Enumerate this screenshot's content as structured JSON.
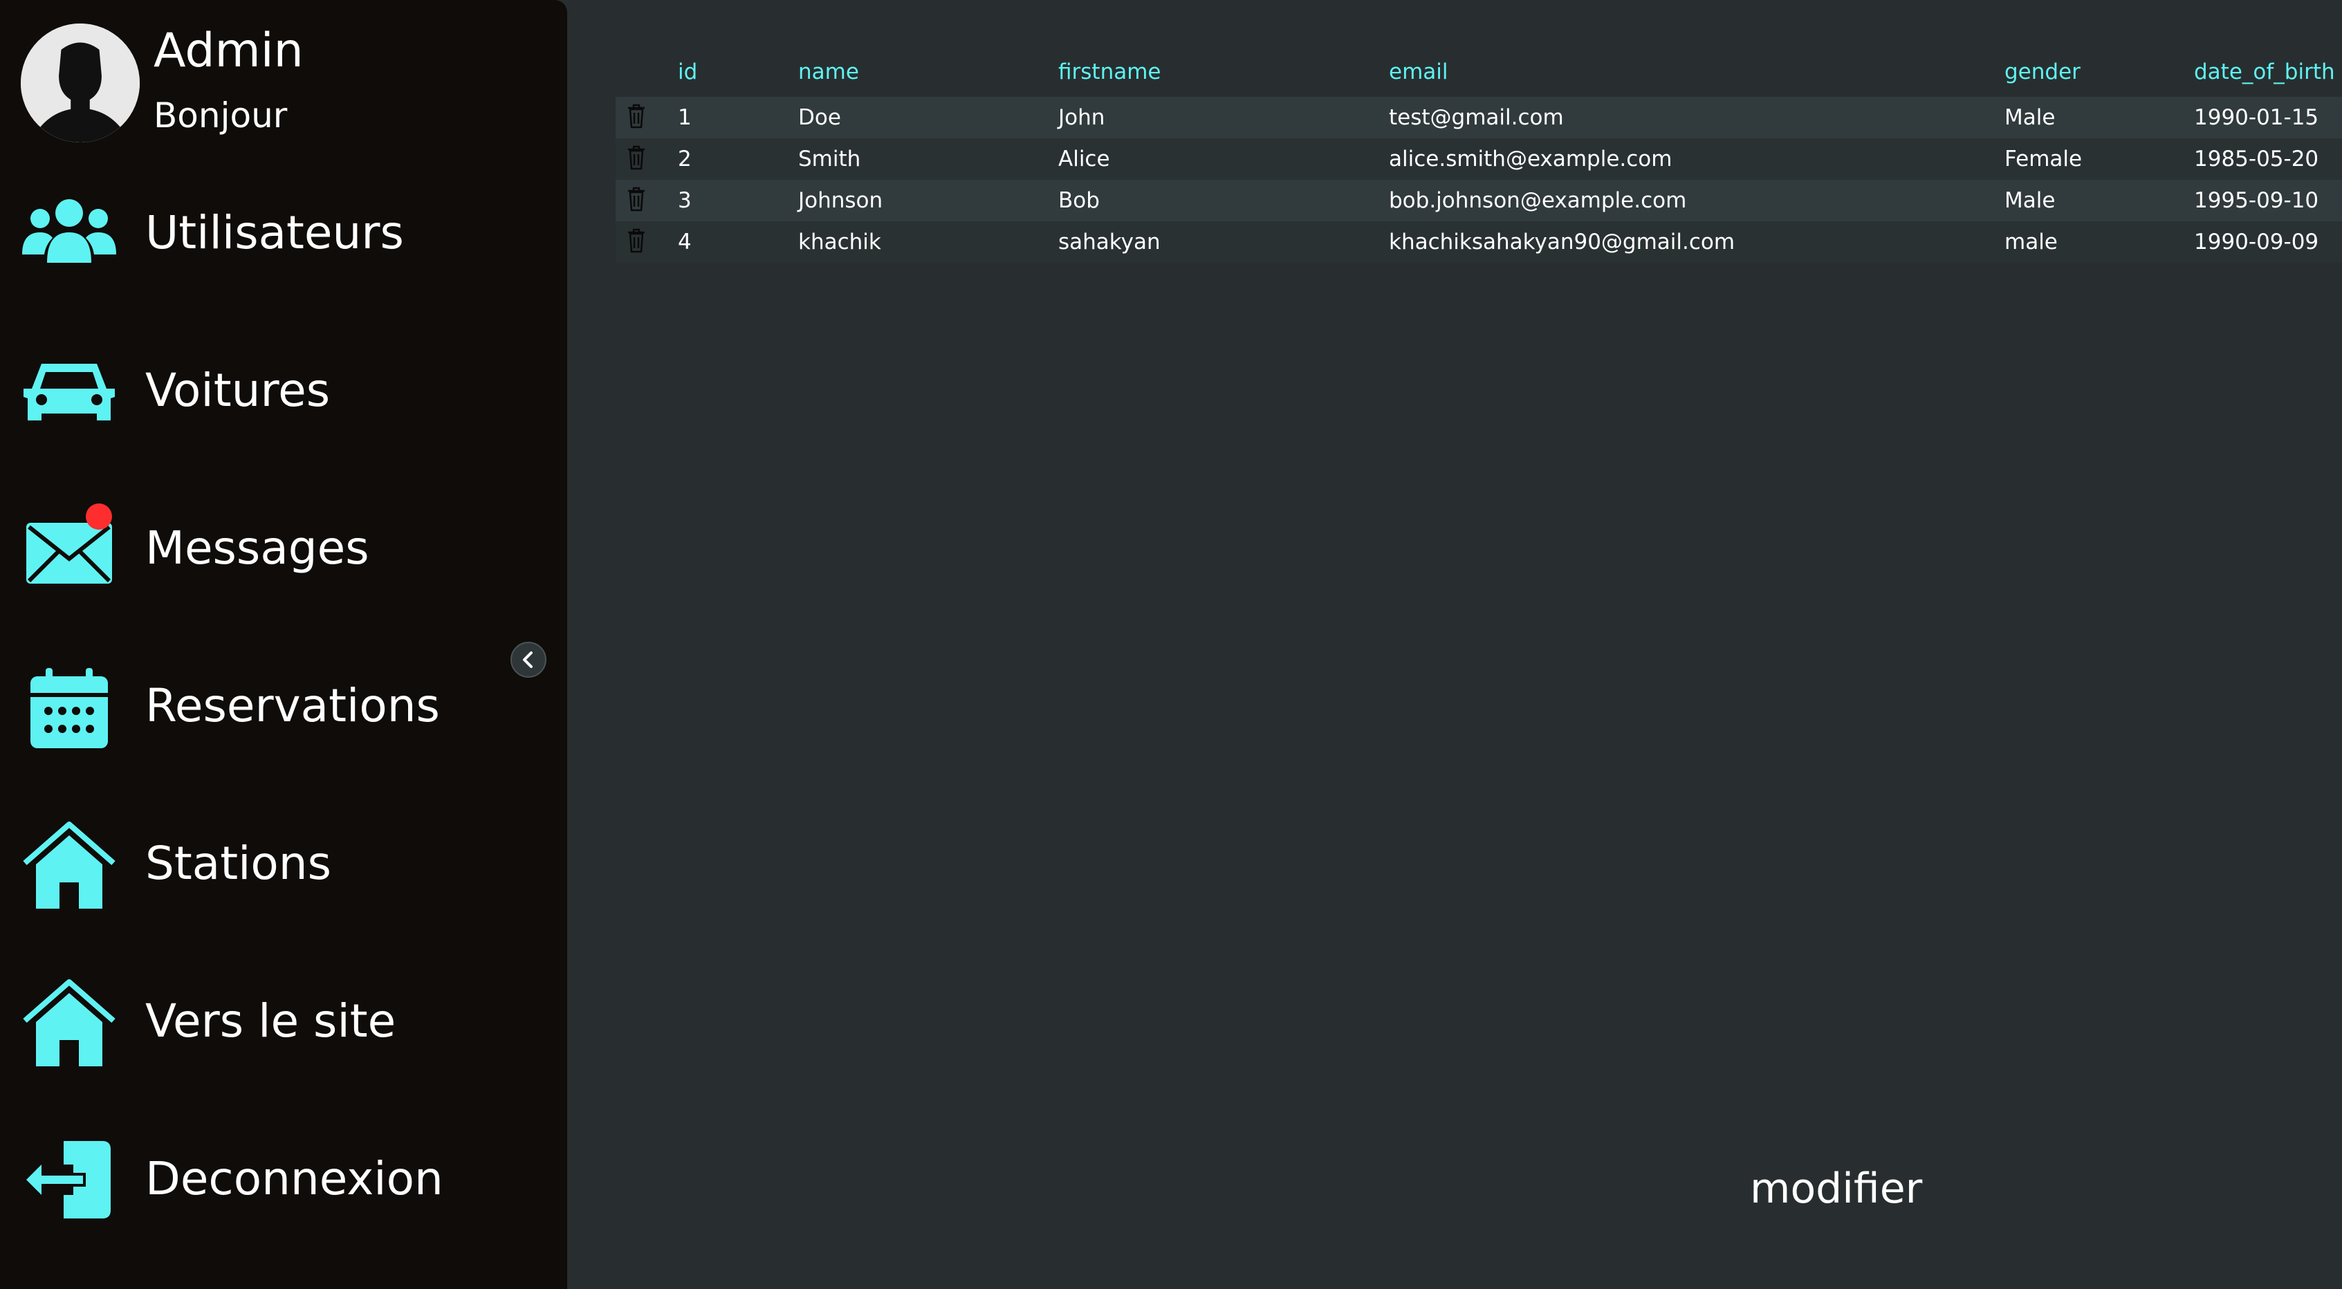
{
  "profile": {
    "name": "Admin",
    "greeting": "Bonjour"
  },
  "nav": {
    "items": [
      {
        "label": "Utilisateurs",
        "icon": "users-icon"
      },
      {
        "label": "Voitures",
        "icon": "car-icon"
      },
      {
        "label": "Messages",
        "icon": "envelope-icon",
        "badge": true
      },
      {
        "label": "Reservations",
        "icon": "calendar-icon"
      },
      {
        "label": "Stations",
        "icon": "house-icon"
      },
      {
        "label": "Vers le site",
        "icon": "house-icon"
      },
      {
        "label": "Deconnexion",
        "icon": "logout-icon"
      }
    ]
  },
  "colors": {
    "accent": "#5ff2f2",
    "sidebar_bg": "#0f0c09",
    "main_bg": "#282e30",
    "badge": "#ff2e2e"
  },
  "table": {
    "headers": {
      "id": "id",
      "name": "name",
      "firstname": "firstname",
      "email": "email",
      "gender": "gender",
      "date_of_birth": "date_of_birth"
    },
    "rows": [
      {
        "id": "1",
        "name": "Doe",
        "firstname": "John",
        "email": "test@gmail.com",
        "gender": "Male",
        "date_of_birth": "1990-01-15"
      },
      {
        "id": "2",
        "name": "Smith",
        "firstname": "Alice",
        "email": "alice.smith@example.com",
        "gender": "Female",
        "date_of_birth": "1985-05-20"
      },
      {
        "id": "3",
        "name": "Johnson",
        "firstname": "Bob",
        "email": "bob.johnson@example.com",
        "gender": "Male",
        "date_of_birth": "1995-09-10"
      },
      {
        "id": "4",
        "name": "khachik",
        "firstname": "sahakyan",
        "email": "khachiksahakyan90@gmail.com",
        "gender": "male",
        "date_of_birth": "1990-09-09"
      }
    ]
  },
  "actions": {
    "modify_label": "modifier"
  }
}
